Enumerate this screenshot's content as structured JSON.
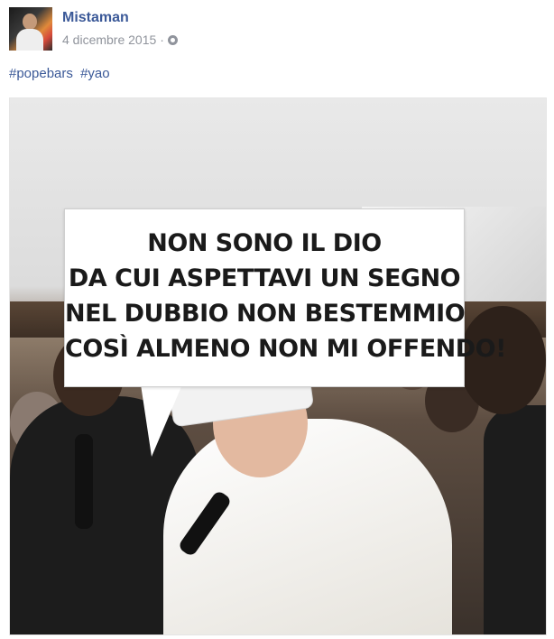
{
  "post": {
    "author": "Mistaman",
    "date": "4 dicembre 2015",
    "separator": "·",
    "privacy_icon": "globe-icon",
    "hashtags": [
      "#popebars",
      "#yao"
    ]
  },
  "image": {
    "bubble_lines": [
      "NON SONO IL DIO",
      "DA CUI ASPETTAVI UN SEGNO",
      "NEL DUBBIO NON BESTEMMIO",
      "COSÌ ALMENO NON MI OFFENDO!"
    ]
  },
  "colors": {
    "link": "#3b5998",
    "meta": "#90949c"
  }
}
